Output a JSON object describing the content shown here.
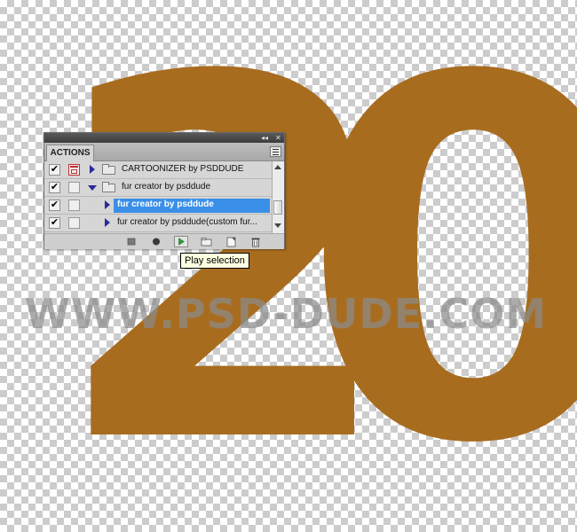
{
  "canvas": {
    "digits": [
      "2",
      "0"
    ],
    "digit_color": "#a86c1f",
    "watermark": "WWW.PSD-DUDE.COM"
  },
  "actions_panel": {
    "tab_label": "ACTIONS",
    "collapse_glyph": "◂◂",
    "close_glyph": "✕",
    "rows": [
      {
        "label": "CARTOONIZER by PSDDUDE",
        "checked": true,
        "dialog": true,
        "type": "set",
        "expanded": false
      },
      {
        "label": "fur creator by psddude",
        "checked": true,
        "dialog": false,
        "type": "set",
        "expanded": true
      },
      {
        "label": "fur creator by psddude",
        "checked": true,
        "dialog": false,
        "type": "action",
        "selected": true
      },
      {
        "label": "fur creator by psddude(custom fur...",
        "checked": true,
        "dialog": false,
        "type": "action",
        "selected": false
      }
    ],
    "check_glyph": "✔",
    "bottom_buttons": [
      "stop-icon",
      "record-icon",
      "play-icon",
      "new-set-icon",
      "new-action-icon",
      "delete-icon"
    ]
  },
  "tooltip": {
    "text": "Play selection"
  }
}
